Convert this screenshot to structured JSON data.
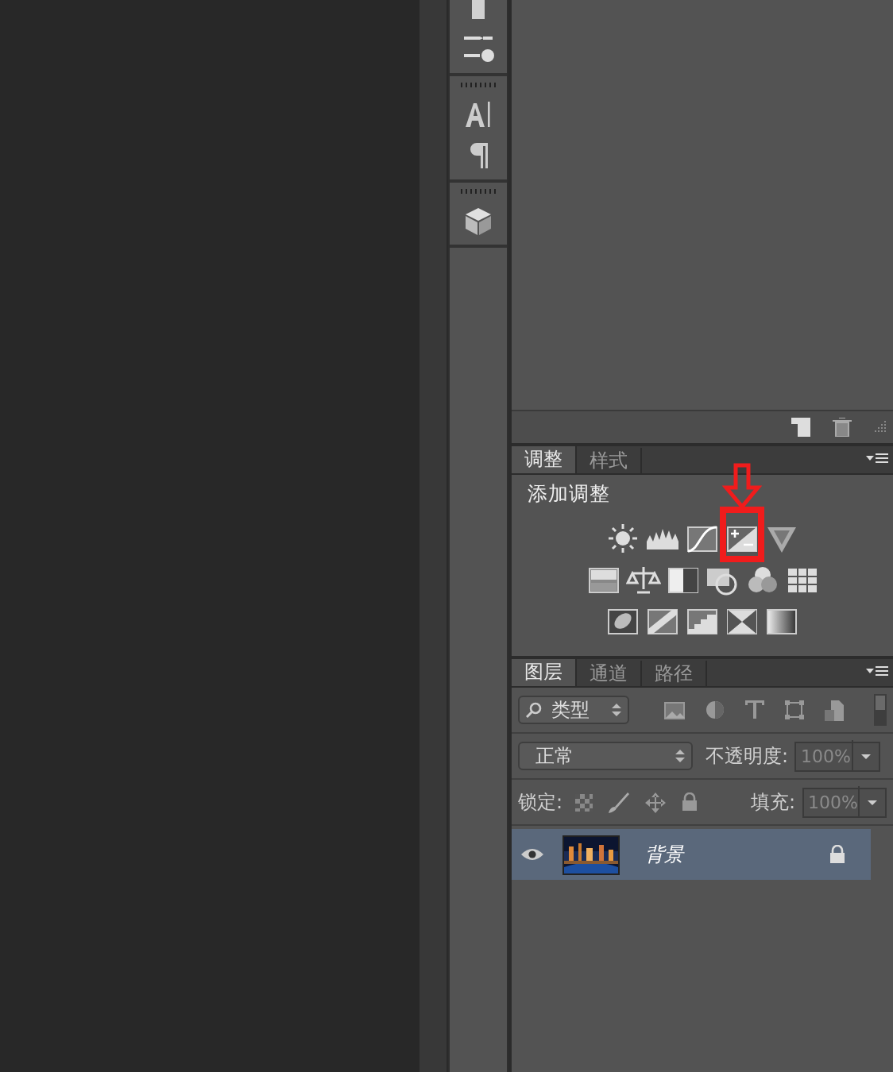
{
  "adjustments": {
    "tabs": [
      {
        "label": "调整",
        "selected": true
      },
      {
        "label": "样式",
        "selected": false
      }
    ],
    "title": "添加调整",
    "icon_rows": [
      [
        {
          "kind": "brightness",
          "highlighted": false
        },
        {
          "kind": "levels",
          "highlighted": false
        },
        {
          "kind": "curves",
          "highlighted": false
        },
        {
          "kind": "exposure",
          "highlighted": true
        },
        {
          "kind": "vibrance",
          "highlighted": false
        }
      ],
      [
        {
          "kind": "hue",
          "highlighted": false
        },
        {
          "kind": "balance",
          "highlighted": false
        },
        {
          "kind": "blackwhite",
          "highlighted": false
        },
        {
          "kind": "photofilter",
          "highlighted": false
        },
        {
          "kind": "mixer",
          "highlighted": false
        },
        {
          "kind": "lookup",
          "highlighted": false
        }
      ],
      [
        {
          "kind": "invert",
          "highlighted": false
        },
        {
          "kind": "posterize",
          "highlighted": false
        },
        {
          "kind": "threshold",
          "highlighted": false
        },
        {
          "kind": "selective",
          "highlighted": false
        },
        {
          "kind": "gradient",
          "highlighted": false
        }
      ]
    ]
  },
  "layers": {
    "tabs": [
      {
        "label": "图层",
        "selected": true
      },
      {
        "label": "通道",
        "selected": false
      },
      {
        "label": "路径",
        "selected": false
      }
    ],
    "filter": "类型",
    "blend_mode": "正常",
    "opacity_label": "不透明度:",
    "opacity": "100%",
    "lock_label": "锁定:",
    "fill_label": "填充:",
    "fill": "100%",
    "items": [
      {
        "name": "背景",
        "visible": true,
        "selected": true,
        "locked": true
      }
    ]
  }
}
